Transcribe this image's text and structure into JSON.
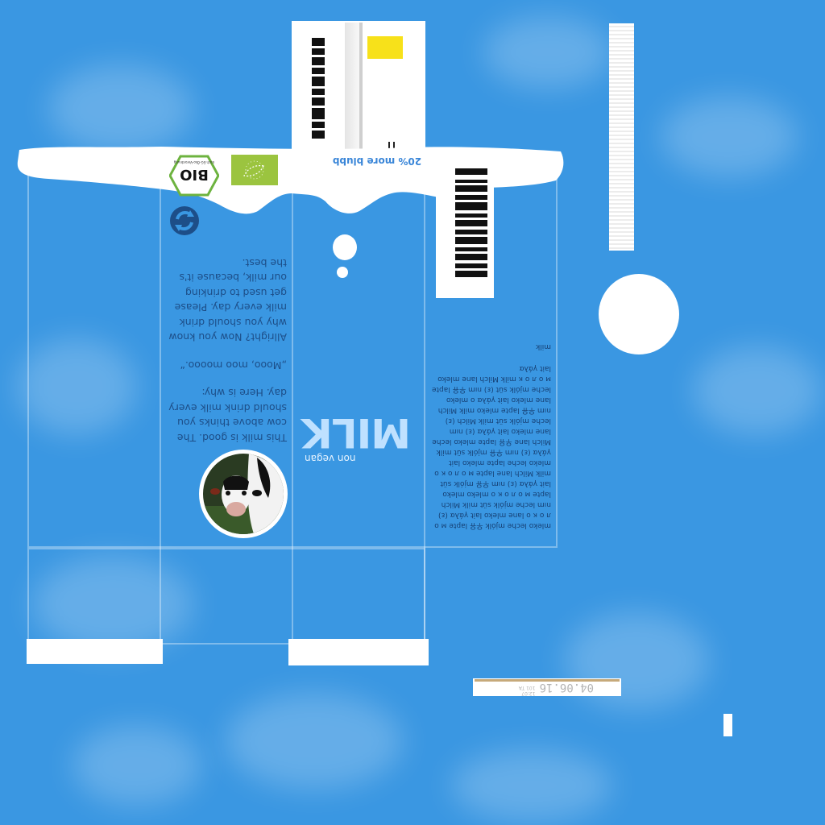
{
  "carton": {
    "tagline": "20% more blubb",
    "product_name": "MILK",
    "product_subtitle": "non vegan",
    "story_intro": "This milk is good. The cow above thinks you should drink milk every day. Here is why:",
    "story_quote": "„Mooo, moo moooo.“",
    "story_outro": "Allright? Now you know why you should drink milk every day. Please get used to drinking our milk, because it's the best.",
    "word_cloud_top": "milk",
    "word_cloud": "mleko leche mjólk 우유 lapte м о л о к о lane mleko lait γάλα (ɛ) nım leche mjólk süt milk Milch lapte м о л о к о mleko mleko lait γάλα (ɛ) nım 우유 mjólk süt milk Milch lane lapte м о л о к о mleko leche lapte mleko lait γάλα (ɛ) nım 우유 mjólk süt milk Milch lane 우유 lapte mleko leche lane mleko lait γάλα (ɛ) nım leche mjólk süt milk Milch (ɛ) nım 우유 lapte mleko milk Milch lane mleko lait γάλα o mleko leche mjólk süt (ɛ) nım 우유 lapte м о л о к milk Milch lane mleko lait γάλα",
    "best_before": "04.06.16",
    "lot_code": "12:07 101 TA",
    "bio_label": "BIO",
    "bio_small": "nach EG-Öko-Verordnung"
  },
  "colors": {
    "sky": "#3a97e2",
    "milk": "#ffffff",
    "bio_green": "#6db33f",
    "eu_leaf": "#9bc43f",
    "accent_yellow": "#f7e11a",
    "text_blue": "#1d4e88"
  },
  "icons": {
    "recycle": "recycle-icon",
    "bio_seal": "bio-seal-icon",
    "eu_organic": "eu-organic-leaf-icon",
    "cow": "cow-photo"
  }
}
